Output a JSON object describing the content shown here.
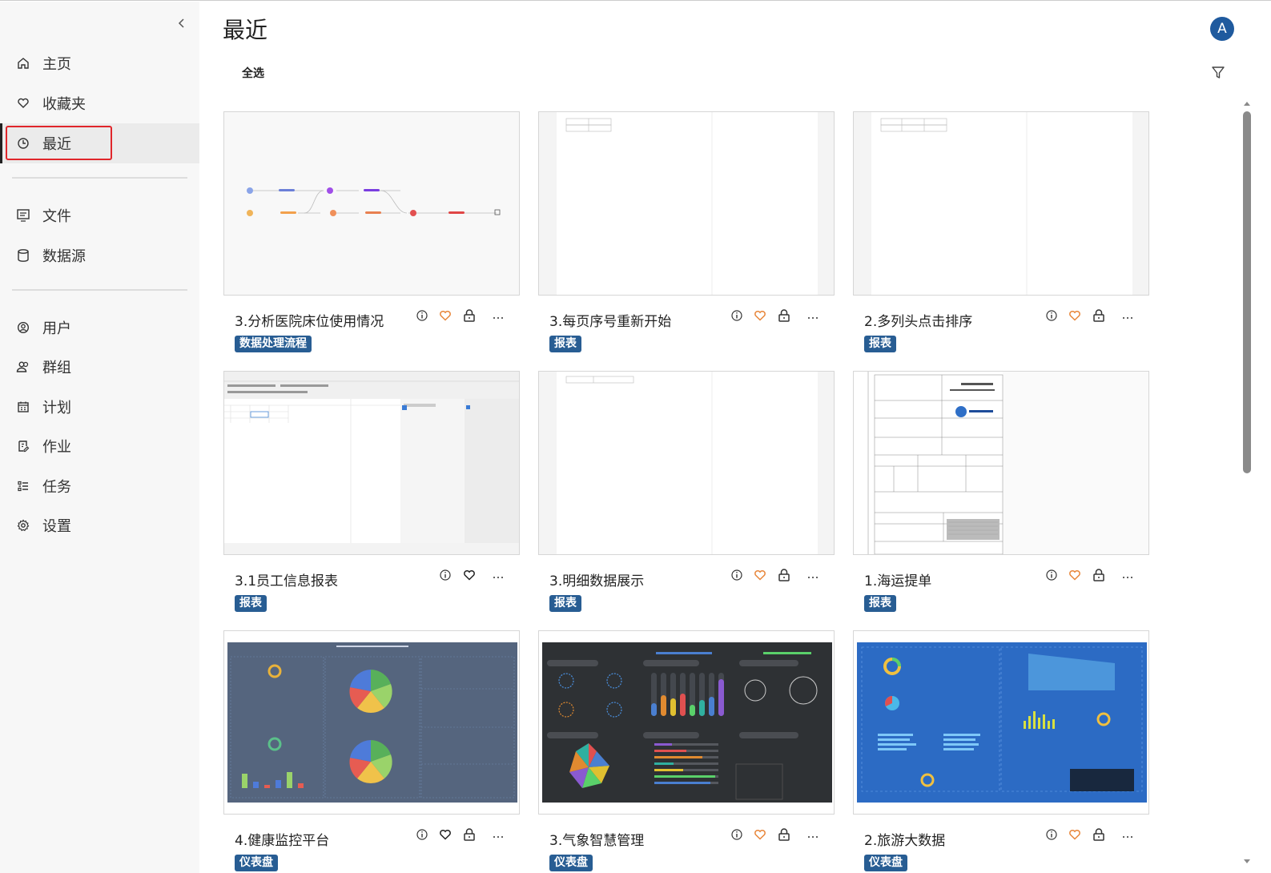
{
  "sidebar": {
    "nav_items": [
      {
        "label": "主页",
        "icon": "home-icon"
      },
      {
        "label": "收藏夹",
        "icon": "heart-icon"
      },
      {
        "label": "最近",
        "icon": "clock-icon",
        "active": true
      },
      {
        "label": "文件",
        "icon": "document-icon"
      },
      {
        "label": "数据源",
        "icon": "database-icon"
      },
      {
        "label": "用户",
        "icon": "user-icon"
      },
      {
        "label": "群组",
        "icon": "group-icon"
      },
      {
        "label": "计划",
        "icon": "calendar-icon"
      },
      {
        "label": "作业",
        "icon": "job-icon"
      },
      {
        "label": "任务",
        "icon": "task-list-icon"
      },
      {
        "label": "设置",
        "icon": "gear-icon"
      }
    ]
  },
  "header": {
    "title": "最近",
    "avatar_initial": "A",
    "select_all": "全选"
  },
  "colors": {
    "tag_bg": "#285d93",
    "favorite_orange": "#e8863a",
    "highlight_red": "#e0262b",
    "avatar_bg": "#1f5a9e"
  },
  "cards": [
    {
      "title": "3.分析医院床位使用情况",
      "tag": "数据处理流程",
      "favorited": true,
      "locked": true,
      "thumbnail": "flow-diagram"
    },
    {
      "title": "3.每页序号重新开始",
      "tag": "报表",
      "favorited": true,
      "locked": true,
      "thumbnail": "blank-report"
    },
    {
      "title": "2.多列头点击排序",
      "tag": "报表",
      "favorited": true,
      "locked": true,
      "thumbnail": "blank-report"
    },
    {
      "title": "3.1员工信息报表",
      "tag": "报表",
      "favorited": false,
      "locked": false,
      "thumbnail": "designer"
    },
    {
      "title": "3.明细数据展示",
      "tag": "报表",
      "favorited": true,
      "locked": true,
      "thumbnail": "blank-report"
    },
    {
      "title": "1.海运提单",
      "tag": "报表",
      "favorited": true,
      "locked": true,
      "thumbnail": "bill-of-lading"
    },
    {
      "title": "4.健康监控平台",
      "tag": "仪表盘",
      "favorited": false,
      "locked": true,
      "thumbnail": "dashboard-slate"
    },
    {
      "title": "3.气象智慧管理",
      "tag": "仪表盘",
      "favorited": true,
      "locked": true,
      "thumbnail": "dashboard-dark"
    },
    {
      "title": "2.旅游大数据",
      "tag": "仪表盘",
      "favorited": true,
      "locked": true,
      "thumbnail": "dashboard-blue"
    }
  ]
}
